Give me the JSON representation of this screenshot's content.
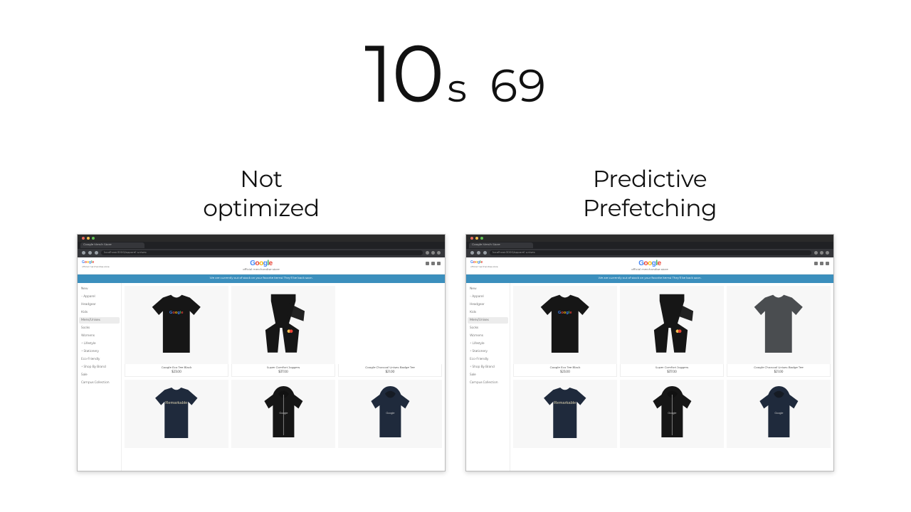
{
  "timer": {
    "seconds": "10",
    "unit": "s",
    "ms": "69"
  },
  "panels": {
    "left": {
      "title_line1": "Not",
      "title_line2": "optimized"
    },
    "right": {
      "title_line1": "Predictive",
      "title_line2": "Prefetching"
    }
  },
  "browser": {
    "tab_title": "Google Merch Store",
    "url": "localhost:3000/apparel-unisex"
  },
  "store": {
    "logo": "Google",
    "subtitle": "official merchandise store",
    "banner": "We are currently out of stock on your favorite items! They'll be back soon.",
    "sidebar": [
      {
        "label": "New",
        "kind": "plain"
      },
      {
        "label": "Apparel",
        "kind": "minus"
      },
      {
        "label": "Headgear",
        "kind": "plain"
      },
      {
        "label": "Kids",
        "kind": "plain"
      },
      {
        "label": "Mens/Unisex",
        "kind": "sel"
      },
      {
        "label": "Socks",
        "kind": "plain"
      },
      {
        "label": "Womens",
        "kind": "plain"
      },
      {
        "label": "Lifestyle",
        "kind": "plus"
      },
      {
        "label": "Stationery",
        "kind": "plus"
      },
      {
        "label": "Eco-Friendly",
        "kind": "plain"
      },
      {
        "label": "Shop By Brand",
        "kind": "plus"
      },
      {
        "label": "Sale",
        "kind": "plain"
      },
      {
        "label": "Campus Collection",
        "kind": "plain"
      }
    ],
    "products_row1": [
      {
        "name": "Google Eco Tee Black",
        "price": "$23.00",
        "art": "tshirt-black"
      },
      {
        "name": "Super Comfort Joggers",
        "price": "$37.00",
        "art": "pants-black"
      },
      {
        "name": "Google Charcoal Unisex Badge Tee",
        "price": "$21.00",
        "art": "tshirt-grey"
      }
    ],
    "products_row2": [
      {
        "art": "tshirt-navy-script"
      },
      {
        "art": "hoodie-black-zip"
      },
      {
        "art": "hoodie-navy"
      }
    ]
  },
  "colors": {
    "banner": "#3b8fbd",
    "black": "#161616",
    "charcoal": "#4a4d50",
    "navy": "#1f2a3c"
  }
}
